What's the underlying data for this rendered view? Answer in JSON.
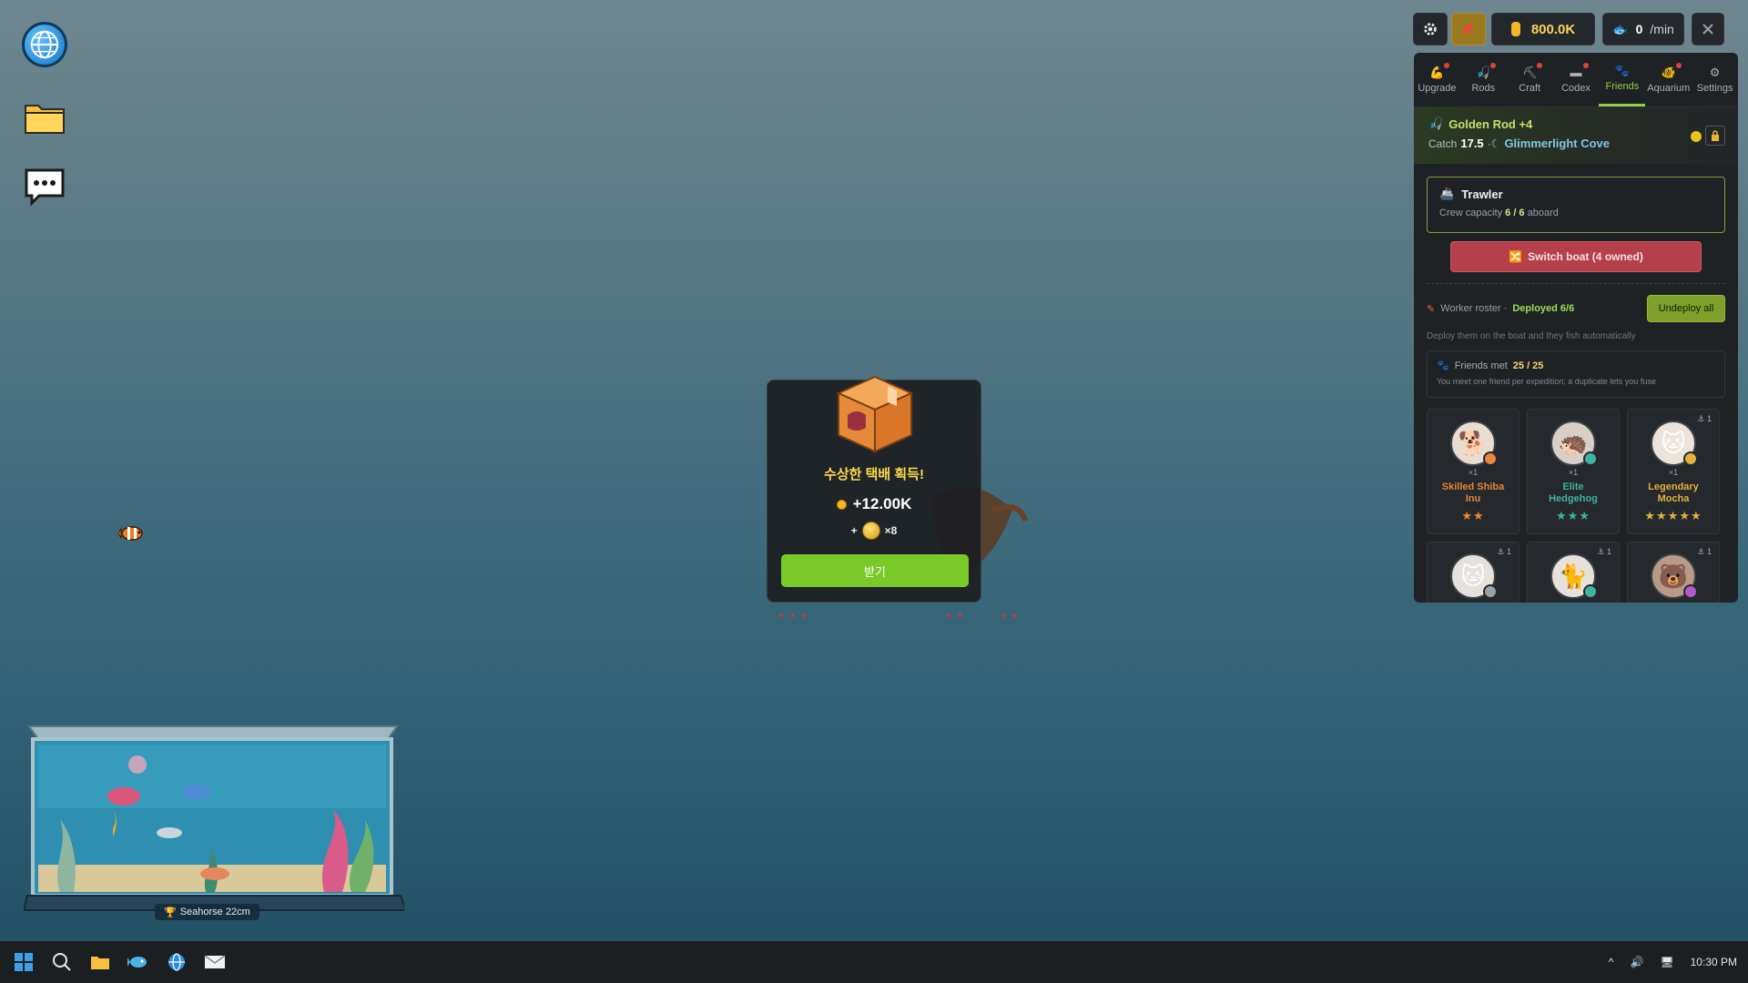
{
  "desktop": {
    "icons": [
      "globe-icon",
      "folder-icon",
      "chat-icon"
    ]
  },
  "aquarium": {
    "label": "Seahorse 22cm"
  },
  "popup": {
    "title": "수상한 택배 획득!",
    "coins": "+12.00K",
    "bonus_prefix": "+",
    "bonus_count": "×8",
    "claim_label": "받기"
  },
  "hud": {
    "gold": "800.0K",
    "rate_value": "0",
    "rate_unit": "/min"
  },
  "tabs": [
    {
      "label": "Upgrade",
      "icon": "upgrade-icon",
      "dot": true
    },
    {
      "label": "Rods",
      "icon": "rods-icon",
      "dot": true
    },
    {
      "label": "Craft",
      "icon": "craft-icon",
      "dot": true
    },
    {
      "label": "Codex",
      "icon": "codex-icon",
      "dot": true
    },
    {
      "label": "Friends",
      "icon": "friends-icon",
      "dot": false,
      "active": true
    },
    {
      "label": "Aquarium",
      "icon": "aquarium-icon",
      "dot": true
    },
    {
      "label": "Settings",
      "icon": "settings-icon",
      "dot": false
    }
  ],
  "rod": {
    "name": "Golden Rod +4",
    "catch_label": "Catch",
    "catch_value": "17.5",
    "location": "Glimmerlight Cove"
  },
  "boat": {
    "name": "Trawler",
    "crew_label": "Crew capacity",
    "crew_value": "6 / 6",
    "crew_suffix": "aboard",
    "switch_label": "Switch boat (4 owned)"
  },
  "roster": {
    "label": "Worker roster ·",
    "deployed": "Deployed 6/6",
    "undeploy_label": "Undeploy all",
    "hint": "Deploy them on the boat and they fish automatically"
  },
  "friends_met": {
    "label": "Friends met",
    "value": "25 / 25",
    "desc": "You meet one friend per expedition; a duplicate lets you fuse"
  },
  "friends": [
    {
      "name_line1": "Skilled Shiba",
      "name_line2": "Inu",
      "count": "×1",
      "stars": "★★",
      "color": "#e8863a",
      "anchor": ""
    },
    {
      "name_line1": "Elite",
      "name_line2": "Hedgehog",
      "count": "×1",
      "stars": "★★★",
      "color": "#3fb3a0",
      "anchor": ""
    },
    {
      "name_line1": "Legendary",
      "name_line2": "Mocha",
      "count": "×1",
      "stars": "★★★★★",
      "color": "#e0b23a",
      "anchor": "⚓ 1"
    },
    {
      "name_line1": "",
      "name_line2": "",
      "count": "",
      "stars": "",
      "color": "#9aa1a7",
      "anchor": "⚓ 1"
    },
    {
      "name_line1": "",
      "name_line2": "",
      "count": "",
      "stars": "",
      "color": "#3fb3a0",
      "anchor": "⚓ 1"
    },
    {
      "name_line1": "",
      "name_line2": "",
      "count": "",
      "stars": "",
      "color": "#b05ac8",
      "anchor": "⚓ 1"
    }
  ],
  "taskbar": {
    "time": "10:30 PM",
    "tray_caret": "^"
  }
}
